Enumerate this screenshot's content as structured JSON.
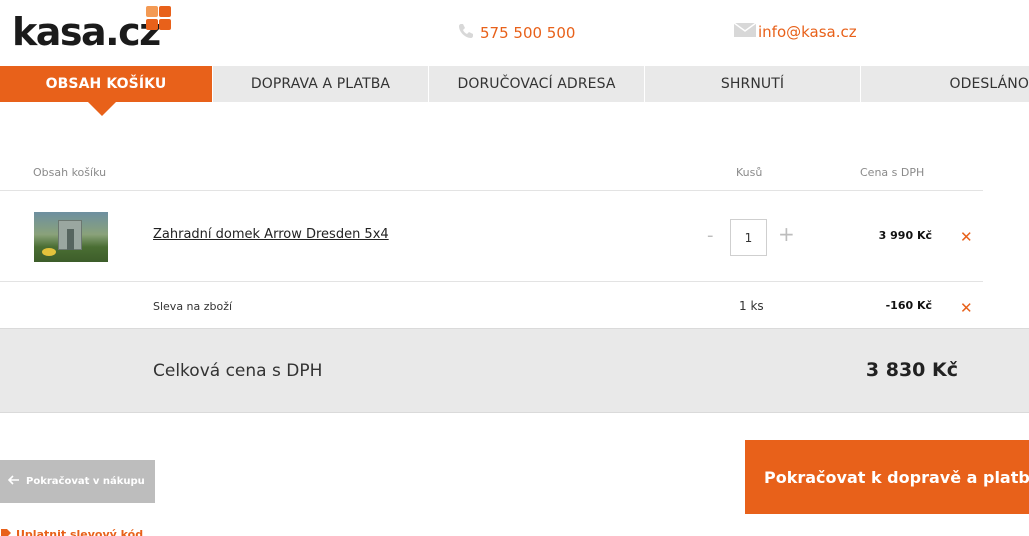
{
  "header": {
    "logo_text": "kasa.cz",
    "phone": "575 500 500",
    "email": "info@kasa.cz",
    "accent_color": "#e8611a"
  },
  "steps": [
    {
      "label": "OBSAH KOŠÍKU",
      "active": true
    },
    {
      "label": "DOPRAVA A PLATBA",
      "active": false
    },
    {
      "label": "DORUČOVACÍ ADRESA",
      "active": false
    },
    {
      "label": "SHRNUTÍ",
      "active": false
    },
    {
      "label": "ODESLÁNO",
      "active": false
    }
  ],
  "cart": {
    "headers": {
      "content": "Obsah košíku",
      "quantity": "Kusů",
      "price": "Cena s DPH"
    },
    "items": [
      {
        "name": "Zahradní domek Arrow Dresden 5x4",
        "quantity": "1",
        "price": "3 990 Kč",
        "minus": "-",
        "plus": "+",
        "remove_icon": "close-icon"
      }
    ],
    "discount": {
      "label": "Sleva na zboží",
      "quantity": "1 ks",
      "price": "-160 Kč"
    },
    "total": {
      "label": "Celková cena s DPH",
      "value": "3 830 Kč"
    }
  },
  "actions": {
    "back_label": "Pokračovat v nákupu",
    "next_label": "Pokračovat k dopravě a platbě",
    "coupon_label": "Uplatnit slevový kód"
  }
}
